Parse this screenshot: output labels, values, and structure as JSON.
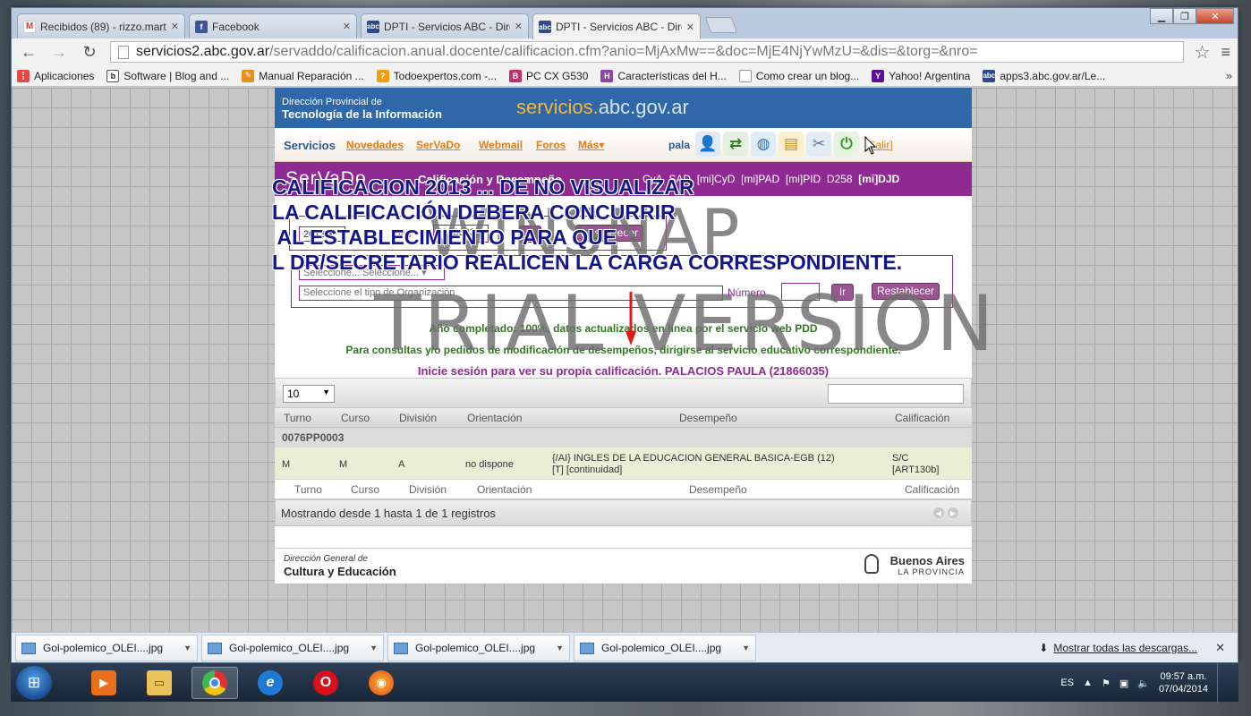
{
  "browser": {
    "tabs": [
      {
        "label": "Recibidos (89) - rizzo.mart",
        "icon": "gmail-icon",
        "active": false
      },
      {
        "label": "Facebook",
        "icon": "facebook-icon",
        "active": false
      },
      {
        "label": "DPTI - Servicios ABC - Dire",
        "icon": "abc-icon",
        "active": false
      },
      {
        "label": "DPTI - Servicios ABC - Dire",
        "icon": "abc-icon",
        "active": true
      }
    ],
    "url_host": "servicios2.abc.gov.ar",
    "url_path": "/servaddo/calificacion.anual.docente/calificacion.cfm?anio=MjAxMw==&doc=MjE4NjYwMzU=&dis=&torg=&nro=",
    "bookmarks": [
      "Aplicaciones",
      "Software | Blog and ...",
      "Manual Reparación ...",
      "Todoexpertos.com -...",
      "PC CX G530",
      "Características del H...",
      "Como crear un blog...",
      "Yahoo! Argentina",
      "apps3.abc.gov.ar/Le..."
    ],
    "bookmarks_more": "»"
  },
  "site": {
    "header": {
      "org_line1": "Dirección Provincial de",
      "org_line2": "Tecnología de la Información",
      "brand_main": "servicios.",
      "brand_domain": "abc.gov.ar"
    },
    "nav": {
      "items": [
        "Servicios",
        "Novedades",
        "SerVaDo",
        "Webmail",
        "Foros",
        "Más▾"
      ],
      "user": "pala",
      "salir": "[Salir]"
    },
    "servado": {
      "logo": "SerVaDo",
      "subtitle": "Calificación y Desempeño",
      "links": [
        "CyA",
        "SAD",
        "[mi]",
        "CyD",
        "[mi]",
        "PAD",
        "[mi]",
        "PID",
        "D258",
        "[mi]DJD"
      ]
    },
    "form1": {
      "year": "2013 ▾",
      "dni_label": "DNI",
      "dni_value": "21866035",
      "go_label": "Ir",
      "reset_label": "Restablecer"
    },
    "form2": {
      "select1": "Seleccione...   Seleccione...   ▾",
      "select_org_placeholder": "Seleccione el tipo de Organización",
      "numero_label": "Número",
      "go_label": "Ir",
      "reset_label": "Restablecer"
    },
    "info": {
      "line1": "Año completado: 100%, datos actualizados en línea por el servicio web PDD",
      "line2": "Para consultas y/o pedidos de modificación de desempeños, dirigirse al servicio educativo correspondiente.",
      "line3": "Inicie sesión para ver su propia calificación. PALACIOS PAULA (21866035)"
    },
    "table": {
      "page_length": "10",
      "headers": [
        "Turno",
        "Curso",
        "División",
        "Orientación",
        "Desempeño",
        "Calificación"
      ],
      "group": "0076PP0003",
      "rows": [
        {
          "turno": "M",
          "curso": "M",
          "division": "A",
          "orientacion": "no dispone",
          "desempeno_1": "{/AI} INGLES DE LA EDUCACION GENERAL BASICA-EGB (12)",
          "desempeno_2": "[T] [continuidad]",
          "calif_1": "S/C",
          "calif_2": "[ART130b]"
        }
      ],
      "info_text": "Mostrando desde 1 hasta 1 de 1 registros"
    },
    "footer": {
      "left_1": "Dirección General de",
      "left_2": "Cultura y Educación",
      "right_1": "Buenos Aires",
      "right_2": "LA PROVINCIA"
    }
  },
  "overlay": {
    "annotation_lines": [
      "CALIFICACION 2013 ... DE NO VISUALIZAR",
      "LA CALIFICACIÓN DEBERA CONCURRIR",
      " AL ESTABLECIMIENTO PARA QUE",
      "L DR/SECRETARIO REALICEN LA CARGA CORRESPONDIENTE."
    ],
    "watermark_1": "WINSNAP",
    "watermark_2": "TRIAL VERSION"
  },
  "downloads": {
    "items": [
      "Gol-polemico_OLEI....jpg",
      "Gol-polemico_OLEI....jpg",
      "Gol-polemico_OLEI....jpg",
      "Gol-polemico_OLEI....jpg"
    ],
    "show_all": "Mostrar todas las descargas...",
    "close": "✕"
  },
  "taskbar": {
    "lang": "ES",
    "time": "09:57 a.m.",
    "date": "07/04/2014"
  },
  "colors": {
    "site_blue": "#2f68a9",
    "servado_purple": "#8f2a93",
    "nav_orange": "#e87b14",
    "annotation_blue": "#14178b"
  }
}
